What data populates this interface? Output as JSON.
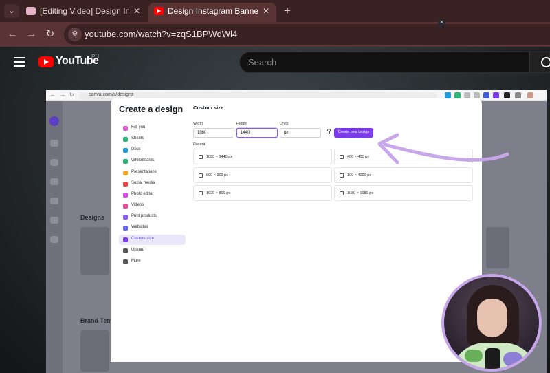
{
  "browser": {
    "tabs": [
      {
        "label": "[Editing Video] Design Instagram",
        "close": "✕"
      },
      {
        "label": "Design Instagram Banner Posts",
        "close": "✕"
      }
    ],
    "new_tab": "+",
    "url": "youtube.com/watch?v=zqS1BPWdWl4"
  },
  "youtube": {
    "wordmark": "YouTube",
    "country": "PH",
    "search_placeholder": "Search"
  },
  "video_browser": {
    "url": "canva.com/s/designs"
  },
  "canva_background": {
    "designs_heading": "Designs",
    "brand_heading": "Brand Tem"
  },
  "create_design": {
    "title": "Create a design",
    "sidebar": [
      {
        "label": "For you",
        "icon": "sparkle-icon",
        "color": "#e25ed7"
      },
      {
        "label": "Sheets",
        "icon": "sheets-icon",
        "color": "#2bb673"
      },
      {
        "label": "Docs",
        "icon": "docs-icon",
        "color": "#1f9bde"
      },
      {
        "label": "Whiteboards",
        "icon": "whiteboard-icon",
        "color": "#2bb673"
      },
      {
        "label": "Presentations",
        "icon": "presentation-icon",
        "color": "#f5a623"
      },
      {
        "label": "Social media",
        "icon": "heart-icon",
        "color": "#ef4444"
      },
      {
        "label": "Photo editor",
        "icon": "photo-icon",
        "color": "#d946ef"
      },
      {
        "label": "Videos",
        "icon": "video-icon",
        "color": "#ec4899"
      },
      {
        "label": "Print products",
        "icon": "print-icon",
        "color": "#8b5cf6"
      },
      {
        "label": "Websites",
        "icon": "website-icon",
        "color": "#6366f1"
      },
      {
        "label": "Custom size",
        "icon": "custom-size-icon",
        "color": "#7c3aed"
      },
      {
        "label": "Upload",
        "icon": "upload-icon",
        "color": "#555555"
      },
      {
        "label": "More",
        "icon": "more-icon",
        "color": "#555555"
      }
    ],
    "active_item": "Custom size",
    "custom_size": {
      "title": "Custom size",
      "width_label": "Width",
      "height_label": "Height",
      "units_label": "Units",
      "width_value": "1080",
      "height_value": "1440",
      "units_value": "px",
      "create_button": "Create new design",
      "recent_label": "Recent",
      "recent": [
        "1080 × 1440 px",
        "400 × 400 px",
        "600 × 300 px",
        "100 × 4000 px",
        "1920 × 800 px",
        "1080 × 1080 px"
      ]
    },
    "close": "✕"
  },
  "colors": {
    "accent_purple": "#7c3aed",
    "annotation": "#c7a6ea",
    "chrome_tab": "#5a3434"
  }
}
